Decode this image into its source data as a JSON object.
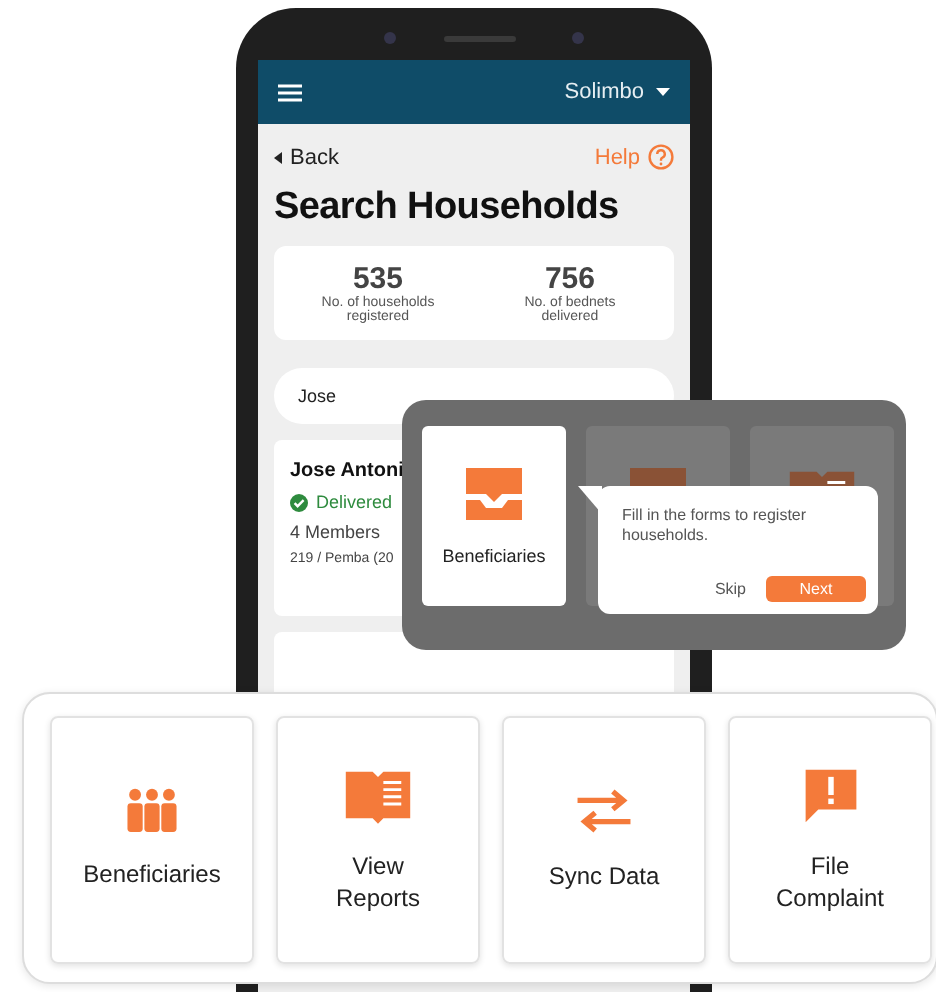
{
  "header": {
    "account": "Solimbo"
  },
  "back": "Back",
  "help": "Help",
  "title": "Search Households",
  "stats": [
    {
      "value": "535",
      "label": "No. of households registered"
    },
    {
      "value": "756",
      "label": "No. of bednets delivered"
    }
  ],
  "search": {
    "value": "Jose"
  },
  "result": {
    "name": "Jose Antoni",
    "status": "Delivered",
    "members": "4 Members",
    "location": "219 / Pemba (20"
  },
  "tour": {
    "tile_label": "Beneficiaries",
    "message": "Fill in the forms to register households.",
    "skip": "Skip",
    "next": "Next"
  },
  "shortcuts": [
    {
      "kind": "people",
      "label": "Beneficiaries"
    },
    {
      "kind": "book",
      "label": "View Reports"
    },
    {
      "kind": "sync",
      "label": "Sync Data"
    },
    {
      "kind": "complaint",
      "label": "File Complaint"
    }
  ]
}
